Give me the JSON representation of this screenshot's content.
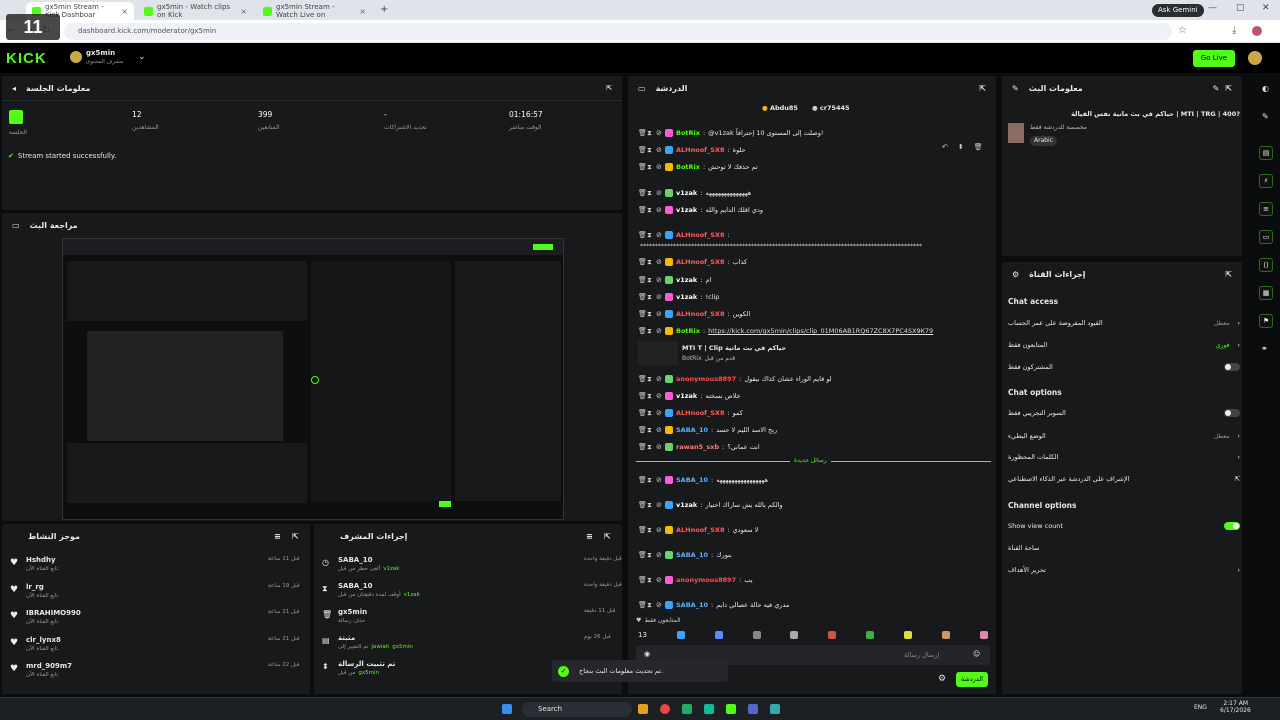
{
  "browser": {
    "tabs": [
      "gx5min Stream - Kick Dashboar",
      "gx5min - Watch clips on Kick",
      "gx5min Stream - Watch Live on"
    ],
    "url": "dashboard.kick.com/moderator/gx5min",
    "gemini": "Ask Gemini"
  },
  "overlay": {
    "k11": "11"
  },
  "header": {
    "logo": "KICK",
    "username": "gx5min",
    "sub": "مشرف المحتوى",
    "golive": "Go Live"
  },
  "session": {
    "title": "معلومات الجلسة",
    "stats": [
      {
        "v": "12",
        "l": "المشاهدين"
      },
      {
        "v": "399",
        "l": "المتابعين"
      },
      {
        "v": "-",
        "l": "تحديد الاشتراكات"
      },
      {
        "v": "01:16:57",
        "l": "الوقت مباشر"
      }
    ],
    "live": "الجلسة",
    "started": "Stream started successfully."
  },
  "preview": {
    "title": "مراجعة البث"
  },
  "activity": {
    "title": "موجز النشاط",
    "items": [
      {
        "name": "Hshdhy",
        "sub": "تابع القناة الآن",
        "time": "قبل 11 ساعة"
      },
      {
        "name": "lr_rg",
        "sub": "تابع القناة الآن",
        "time": "قبل 19 ساعة"
      },
      {
        "name": "IBRAHIMO990",
        "sub": "تابع القناة الآن",
        "time": "قبل 21 ساعة"
      },
      {
        "name": "clr_lynx8",
        "sub": "تابع القناة الآن",
        "time": "قبل 21 ساعة"
      },
      {
        "name": "mrd_909m7",
        "sub": "تابع القناة الآن",
        "time": "قبل 22 ساعة"
      }
    ]
  },
  "modactions": {
    "title": "إجراءات المشرف",
    "items": [
      {
        "name": "SABA_10",
        "sub": "ألغى حظر من قبل",
        "by": "v1zak",
        "time": "قبل دقيقة واحدة"
      },
      {
        "name": "SABA_10",
        "sub": "أوقف لمدة دقيقتان من قبل",
        "by": "v1zak",
        "time": "قبل دقيقة واحدة"
      },
      {
        "name": "gx5min",
        "sub": "حذف رسالة",
        "by": "",
        "time": "قبل 11 دقيقة"
      },
      {
        "name": "مثبتة",
        "sub": "تم التغيير إلى",
        "by": "gx5min",
        "by2": "Jawiah",
        "time": "قبل 26 يوم"
      },
      {
        "name": "تم تثبيت الرسالة",
        "sub": "من قبل",
        "by": "gx5min",
        "time": "قبل 21 يوم"
      }
    ]
  },
  "chat": {
    "title": "الدردشة",
    "top": [
      "Abdu85",
      "cr75445"
    ],
    "lines": [
      {
        "u": "BotRix",
        "c": "#53fc18",
        "m": "@v1zak وصلت إلى المستوى 10 إحترافاً!"
      },
      {
        "u": "ALHnoof_SX8",
        "c": "#ff5b5b",
        "m": "حلوة"
      },
      {
        "u": "BotRix",
        "c": "#53fc18",
        "m": "تم حذفك لا توحش"
      },
      {
        "u": "v1zak",
        "c": "#fff",
        "m": "ههههههههههههههه"
      },
      {
        "u": "v1zak",
        "c": "#fff",
        "m": "ودي اقلك الدايم والله"
      },
      {
        "u": "ALHnoof_SX8",
        "c": "#ff5b5b",
        "m": ""
      },
      {
        "u": "ALHnoof_SX8",
        "c": "#ff5b5b",
        "m": "كذاب"
      },
      {
        "u": "v1zak",
        "c": "#fff",
        "m": "ام"
      },
      {
        "u": "v1zak",
        "c": "#fff",
        "m": "!clip"
      },
      {
        "u": "ALHnoof_SX8",
        "c": "#ff5b5b",
        "m": "الكوين"
      },
      {
        "u": "BotRix",
        "c": "#53fc18",
        "m": "https://kick.com/gx5min/clips/clip_01M06AB1RQ67ZC8X7PC4SX9K79"
      },
      {
        "u": "anonymous8897",
        "c": "#ff4d4d",
        "m": "لو قايم الوراء عشان كذاك بيقول"
      },
      {
        "u": "v1zak",
        "c": "#fff",
        "m": "خلاص نسخته"
      },
      {
        "u": "ALHnoof_SX8",
        "c": "#ff5b5b",
        "m": "كمو"
      },
      {
        "u": "SABA_10",
        "c": "#5fb0ff",
        "m": "ربح الاسد الليم لا حسد"
      },
      {
        "u": "rawan5_sxb",
        "c": "#ff7a7a",
        "m": "انت عماني؟"
      },
      {
        "u": "SABA_10",
        "c": "#5fb0ff",
        "m": "ههههههههههههههههه"
      },
      {
        "u": "v1zak",
        "c": "#fff",
        "m": "والكم بالله يش ساراك اختيار"
      },
      {
        "u": "ALHnoof_SX8",
        "c": "#ff5b5b",
        "m": "لا سعودي"
      },
      {
        "u": "SABA_10",
        "c": "#5fb0ff",
        "m": "بنورك"
      },
      {
        "u": "anonymous8897",
        "c": "#ff4d4d",
        "m": "يب"
      },
      {
        "u": "SABA_10",
        "c": "#5fb0ff",
        "m": "مدري فيه حالة عصالي دايم"
      }
    ],
    "clip": {
      "title": "MTI T | Clip حياكم في بث ماتية",
      "by": "BotRix",
      "sub": "قدم من قبل"
    },
    "newmsgs": "رسائل جديدة",
    "followers_only": "المتابعون فقط",
    "input_ph": "إرسال رسالة",
    "send": "الدردشة",
    "toast": "تم تحديث معلومات البث بنجاح."
  },
  "streaminfo": {
    "title": "معلومات البث",
    "stream_title": "حياكم في بث ماتية نفس القيالة | MTI | TRG | 400?",
    "sub": "مخصصة للدردشة فقط",
    "lang": "Arabic"
  },
  "channel": {
    "title": "إجراءات القناة",
    "chat_access": "Chat access",
    "rows1": [
      {
        "l": "القيود المفروضة على عمر الحساب",
        "v": "معطل"
      },
      {
        "l": "المتابعون فقط",
        "v": "فوري"
      },
      {
        "l": "المشتركون فقط",
        "v": ""
      }
    ],
    "chat_options": "Chat options",
    "rows2": [
      {
        "l": "السوبر التجريبي فقط",
        "v": ""
      },
      {
        "l": "الوضع البطيء",
        "v": "معطل"
      },
      {
        "l": "الكلمات المحظورة",
        "v": ""
      },
      {
        "l": "الإشراف على الدردشة عبر الذكاء الاصطناعي",
        "v": ""
      }
    ],
    "channel_options": "Channel options",
    "rows3": [
      {
        "l": "Show view count",
        "v": ""
      },
      {
        "l": "ساحة القناة",
        "v": ""
      },
      {
        "l": "تحرير الأهداف",
        "v": ""
      }
    ]
  },
  "taskbar": {
    "search": "Search",
    "lang": "ENG",
    "time": "2:17 AM",
    "date": "6/17/2026"
  }
}
